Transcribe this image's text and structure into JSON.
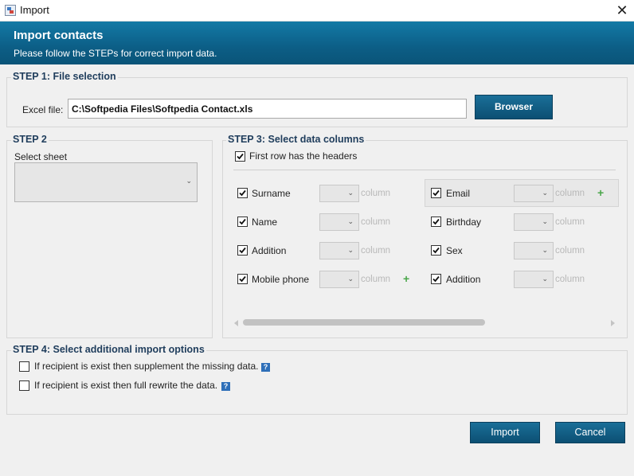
{
  "window": {
    "title": "Import",
    "close_glyph": "✕"
  },
  "header": {
    "title": "Import contacts",
    "subtitle": "Please follow the STEPs for correct import data."
  },
  "step1": {
    "title": "STEP 1: File selection",
    "file_label": "Excel file:",
    "file_value": "C:\\Softpedia Files\\Softpedia Contact.xls",
    "browse_label": "Browser"
  },
  "step2": {
    "title": "STEP 2",
    "sheet_label": "Select sheet",
    "sheet_value": ""
  },
  "step3": {
    "title": "STEP 3: Select data columns",
    "first_row_label": "First row has the headers",
    "first_row_checked": true,
    "column_placeholder": "column",
    "left_columns": [
      {
        "label": "Surname",
        "checked": true,
        "plus": false
      },
      {
        "label": "Name",
        "checked": true,
        "plus": false
      },
      {
        "label": "Addition",
        "checked": true,
        "plus": false
      },
      {
        "label": "Mobile phone",
        "checked": true,
        "plus": true
      }
    ],
    "right_columns": [
      {
        "label": "Email",
        "checked": true,
        "plus": true,
        "highlighted": true
      },
      {
        "label": "Birthday",
        "checked": true,
        "plus": false
      },
      {
        "label": "Sex",
        "checked": true,
        "plus": false
      },
      {
        "label": "Addition",
        "checked": true,
        "plus": false
      }
    ]
  },
  "step4": {
    "title": "STEP 4: Select additional import options",
    "options": [
      {
        "label": "If recipient is exist then supplement the missing data.",
        "checked": false
      },
      {
        "label": "If recipient is exist then full rewrite the data.",
        "checked": false
      }
    ]
  },
  "footer": {
    "import_label": "Import",
    "cancel_label": "Cancel"
  },
  "colors": {
    "header_bg": "#0c5e86",
    "accent_button": "#0c4f73",
    "plus_green": "#4aa64a",
    "section_title": "#1f3d5c"
  }
}
